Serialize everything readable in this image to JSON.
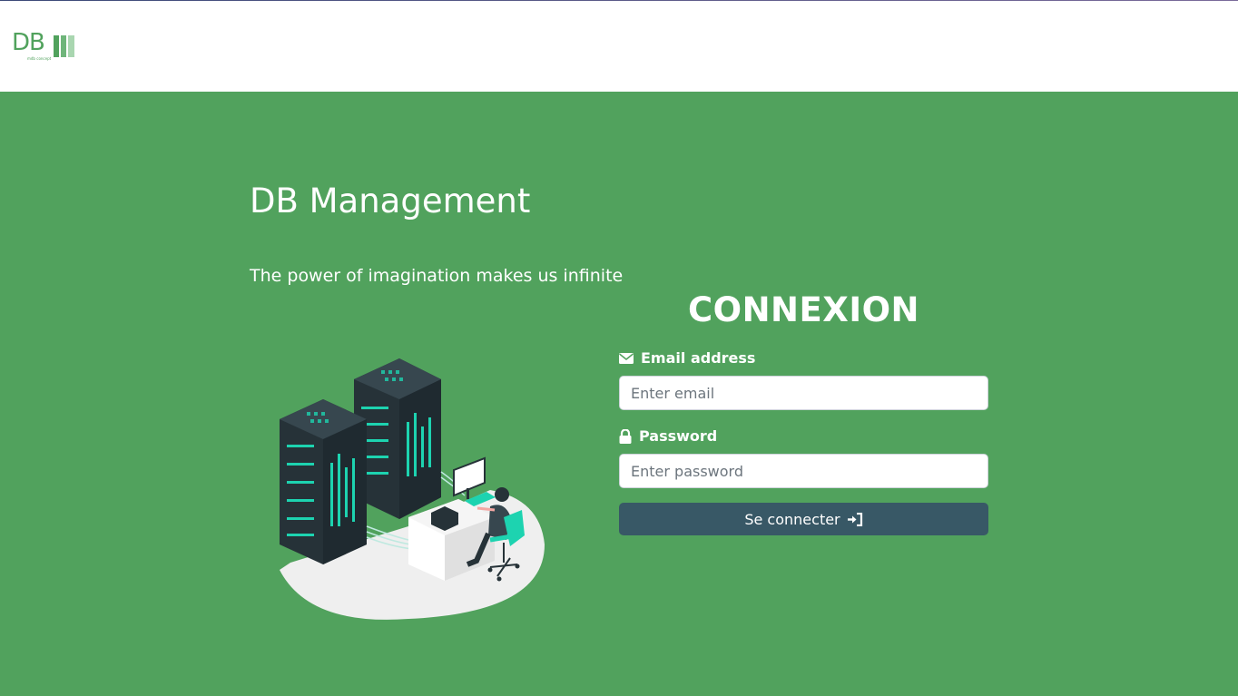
{
  "header": {
    "logo": {
      "text": "DB",
      "subtext": "mdb concept"
    }
  },
  "hero": {
    "title": "DB Management",
    "tagline": "The power of imagination makes us infinite",
    "illustration": "server-room-developer-illustration"
  },
  "login": {
    "title": "CONNEXION",
    "email": {
      "label": "Email address",
      "icon": "envelope-icon",
      "placeholder": "Enter email",
      "value": ""
    },
    "password": {
      "label": "Password",
      "icon": "lock-icon",
      "placeholder": "Enter password",
      "value": ""
    },
    "submit": {
      "label": "Se connecter",
      "icon": "sign-in-icon"
    }
  },
  "colors": {
    "brand_green": "#51a25d",
    "button_dark": "#385866",
    "accent_teal": "#1dd3b0",
    "server_dark": "#263238"
  }
}
